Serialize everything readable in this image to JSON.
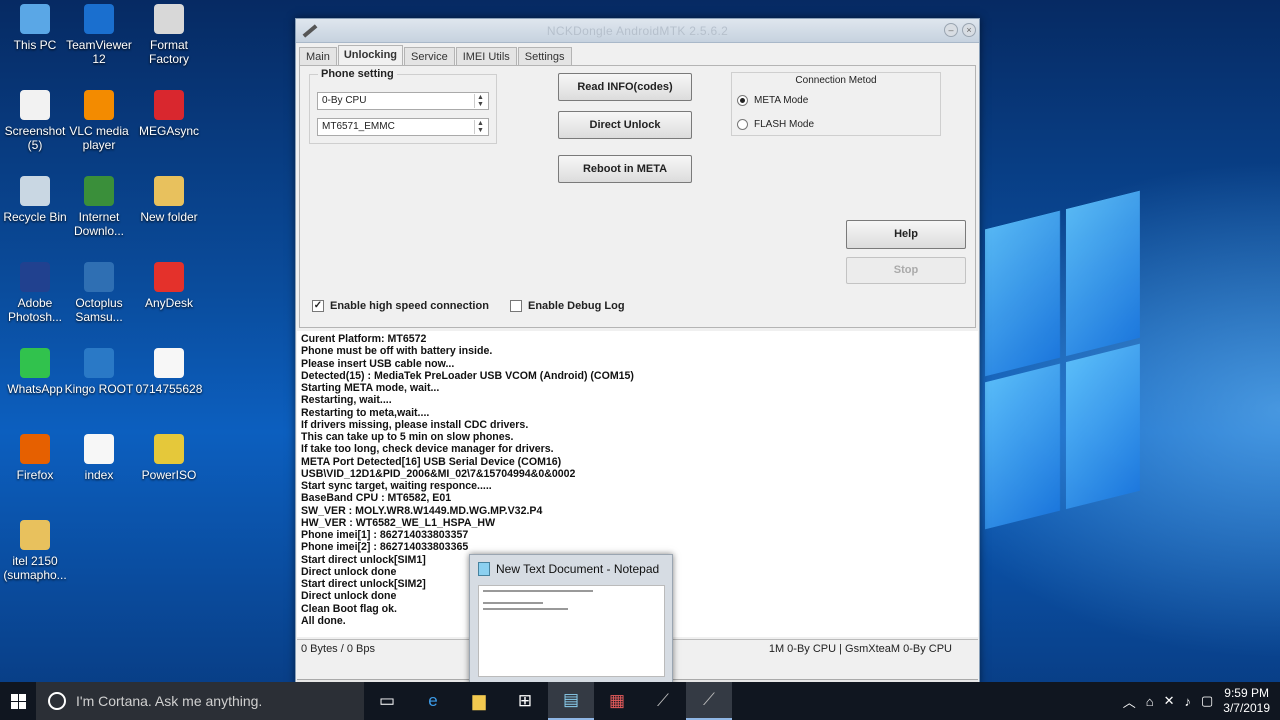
{
  "desktop": {
    "icons": [
      {
        "label": "This PC",
        "icon": "monitor-icon",
        "color": "#5aa7e6"
      },
      {
        "label": "TeamViewer 12",
        "icon": "teamviewer-icon",
        "color": "#1a6fcf"
      },
      {
        "label": "Format Factory",
        "icon": "format-factory-icon",
        "color": "#d8d8d8"
      },
      {
        "label": "Screenshot (5)",
        "icon": "screenshot-file-icon",
        "color": "#f2f2f2"
      },
      {
        "label": "VLC media player",
        "icon": "vlc-icon",
        "color": "#f38b00"
      },
      {
        "label": "MEGAsync",
        "icon": "megasync-icon",
        "color": "#d9272e"
      },
      {
        "label": "Recycle Bin",
        "icon": "recycle-bin-icon",
        "color": "#c9d7e3"
      },
      {
        "label": "Internet Downlo...",
        "icon": "idm-icon",
        "color": "#3a8f3a"
      },
      {
        "label": "New folder",
        "icon": "folder-icon",
        "color": "#e8c15d"
      },
      {
        "label": "Adobe Photosh...",
        "icon": "photoshop-icon",
        "color": "#21418f"
      },
      {
        "label": "Octoplus Samsu...",
        "icon": "octoplus-icon",
        "color": "#2f6fb3"
      },
      {
        "label": "AnyDesk",
        "icon": "anydesk-icon",
        "color": "#e4312b"
      },
      {
        "label": "WhatsApp",
        "icon": "whatsapp-icon",
        "color": "#31c24d"
      },
      {
        "label": "Kingo ROOT",
        "icon": "kingo-root-icon",
        "color": "#2a79c6"
      },
      {
        "label": "0714755628",
        "icon": "text-file-icon",
        "color": "#f7f7f7"
      },
      {
        "label": "Firefox",
        "icon": "firefox-icon",
        "color": "#e66000"
      },
      {
        "label": "index",
        "icon": "barcode-file-icon",
        "color": "#f7f7f7"
      },
      {
        "label": "PowerISO",
        "icon": "poweriso-icon",
        "color": "#e5c83a"
      },
      {
        "label": "itel 2150 (sumapho...",
        "icon": "folder-icon",
        "color": "#e8c15d"
      }
    ]
  },
  "window": {
    "title": "NCKDongle AndroidMTK 2.5.6.2",
    "tabs": [
      "Main",
      "Unlocking",
      "Service",
      "IMEI Utils",
      "Settings"
    ],
    "active_tab": "Unlocking",
    "phone_setting": {
      "label": "Phone setting",
      "cpu_select": "0-By CPU",
      "chip_select": "MT6571_EMMC"
    },
    "buttons": {
      "read_info": "Read INFO(codes)",
      "direct_unlock": "Direct Unlock",
      "reboot_meta": "Reboot in META",
      "help": "Help",
      "stop": "Stop"
    },
    "connection": {
      "label": "Connection Metod",
      "options": [
        "META Mode",
        "FLASH Mode"
      ],
      "selected": "META Mode"
    },
    "checkboxes": {
      "high_speed": {
        "label": "Enable high speed connection",
        "checked": true
      },
      "debug_log": {
        "label": "Enable Debug Log",
        "checked": false
      }
    },
    "log_lines": [
      "Curent Platform: MT6572",
      "Phone must be off with battery inside.",
      "Please insert USB cable now...",
      "Detected(15) : MediaTek PreLoader USB VCOM (Android) (COM15)",
      "Starting META mode, wait...",
      "Restarting, wait....",
      "Restarting to meta,wait....",
      "If drivers missing, please install CDC drivers.",
      "This can take up to 5 min on slow phones.",
      "If take too long, check device manager for drivers.",
      "META Port Detected[16] USB Serial Device (COM16)",
      "USB\\VID_12D1&PID_2006&MI_02\\7&15704994&0&0002",
      "Start sync target, waiting responce.....",
      "BaseBand CPU : MT6582, E01",
      "SW_VER : MOLY.WR8.W1449.MD.WG.MP.V32.P4",
      "HW_VER : WT6582_WE_L1_HSPA_HW",
      "Phone imei[1] : 862714033803357",
      "Phone imei[2] : 862714033803365",
      "Start direct unlock[SIM1]",
      "Direct unlock done",
      "Start direct unlock[SIM2]",
      "Direct unlock done",
      "Clean Boot flag ok.",
      "All done."
    ],
    "status": {
      "left": "0 Bytes / 0 Bps",
      "right": "1M 0-By CPU | GsmXteaM 0-By CPU"
    }
  },
  "notepad_preview": {
    "title": "New Text Document - Notepad"
  },
  "taskbar": {
    "search_placeholder": "I'm Cortana. Ask me anything.",
    "time": "9:59 PM",
    "date": "3/7/2019"
  }
}
